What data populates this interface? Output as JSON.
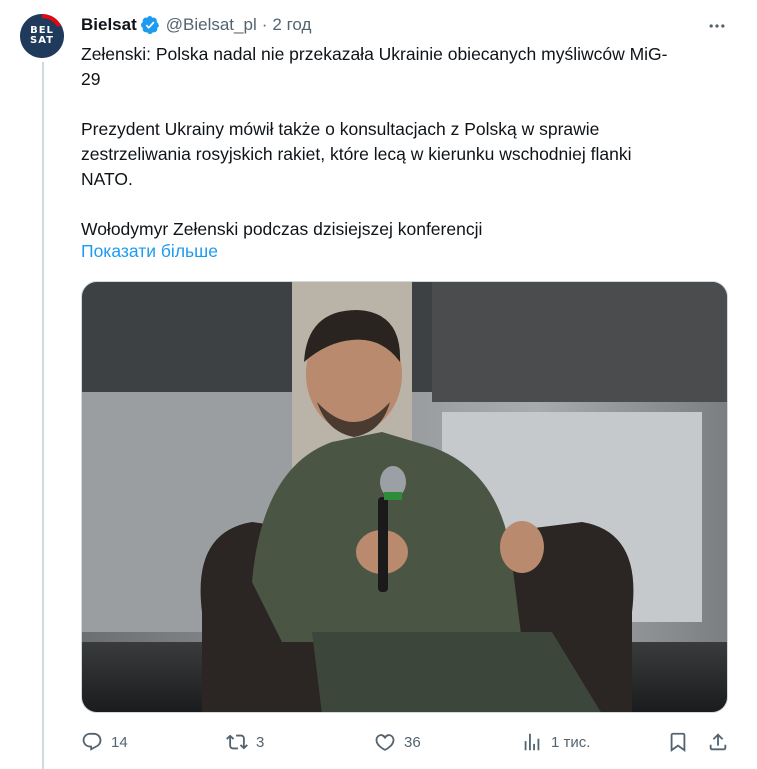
{
  "account": {
    "name": "Bielsat",
    "handle": "@Bielsat_pl",
    "separator": "·",
    "time": "2 год",
    "avatar_line1": "BEL",
    "avatar_line2": "SAT"
  },
  "tweet": {
    "line1": "Zełenski: Polska nadal nie przekazała Ukrainie obiecanych myśliwców MiG-",
    "line2": "29",
    "line3": "Prezydent Ukrainy mówił także o konsultacjach z Polską w sprawie",
    "line4": "zestrzeliwania rosyjskich rakiet, które lecą w kierunku wschodniej flanki",
    "line5": "NATO.",
    "line6": "Wołodymyr Zełenski podczas dzisiejszej konferencji",
    "show_more": "Показати більше"
  },
  "actions": {
    "replies": "14",
    "reposts": "3",
    "likes": "36",
    "views": "1 тис."
  },
  "icons": {
    "verified": "verified-badge-icon",
    "more": "more-horizontal-icon",
    "reply": "reply-icon",
    "repost": "repost-icon",
    "like": "heart-icon",
    "views": "analytics-icon",
    "bookmark": "bookmark-icon",
    "share": "share-icon"
  },
  "colors": {
    "accent": "#1d9bf0",
    "text": "#0f1419",
    "secondary": "#536471",
    "avatar_bg": "#1f3a5a",
    "avatar_accent": "#e30613"
  }
}
